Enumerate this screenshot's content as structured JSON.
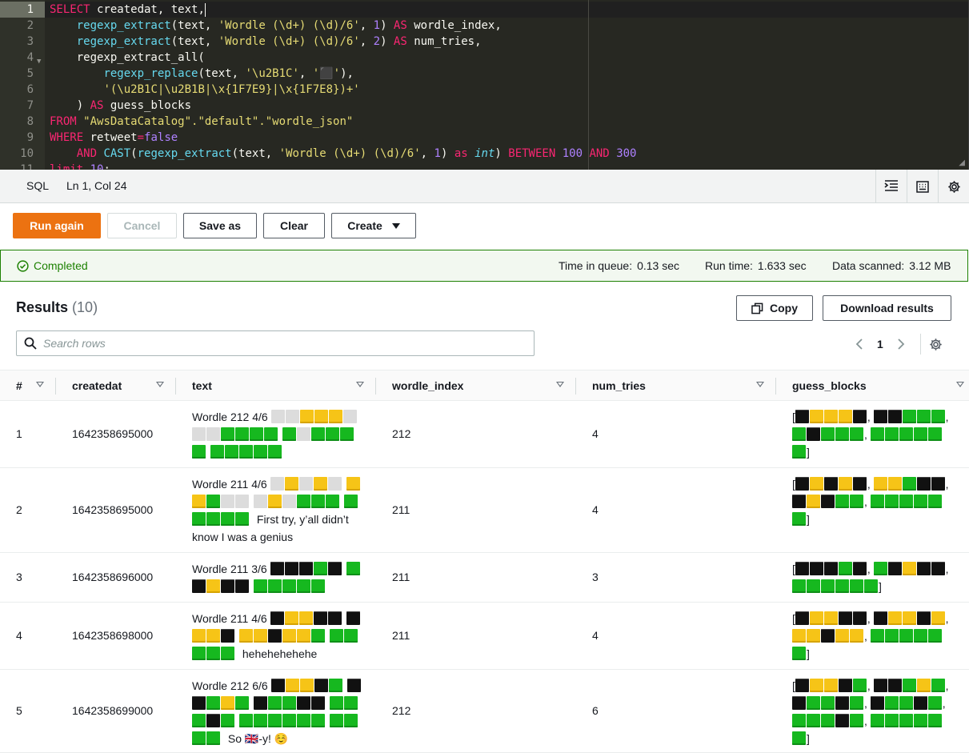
{
  "editor": {
    "line_numbers": [
      "1",
      "2",
      "3",
      "4",
      "5",
      "6",
      "7",
      "8",
      "9",
      "10",
      "11"
    ],
    "code_lines": [
      "<span class=\"k\">SELECT</span> createdat, text,<span class=\"caret\"></span>",
      "    <span class=\"f\">regexp_extract</span>(text, <span class=\"s\">'Wordle (\\d+) (\\d)/6'</span>, <span class=\"n\">1</span>) <span class=\"k\">AS</span> wordle_index,",
      "    <span class=\"f\">regexp_extract</span>(text, <span class=\"s\">'Wordle (\\d+) (\\d)/6'</span>, <span class=\"n\">2</span>) <span class=\"k\">AS</span> num_tries,",
      "    regexp_extract_all(",
      "        <span class=\"f\">regexp_replace</span>(text, <span class=\"s\">'\\u2B1C'</span>, <span class=\"s\">'⬛'</span>),",
      "        <span class=\"s\">'(\\u2B1C|\\u2B1B|\\x{1F7E9}|\\x{1F7E8})+'</span>",
      "    ) <span class=\"k\">AS</span> guess_blocks",
      "<span class=\"k\">FROM</span> <span class=\"s\">\"AwsDataCatalog\".\"default\".\"wordle_json\"</span>",
      "<span class=\"k\">WHERE</span> retweet<span class=\"o\">=</span><span class=\"n\">false</span>",
      "    <span class=\"k\">AND</span> <span class=\"f\">CAST</span>(<span class=\"f\">regexp_extract</span>(text, <span class=\"s\">'Wordle (\\d+) (\\d)/6'</span>, <span class=\"n\">1</span>) <span class=\"k\">as</span> <span class=\"t\">int</span>) <span class=\"k\">BETWEEN</span> <span class=\"n\">100</span> <span class=\"k\">AND</span> <span class=\"n\">300</span>",
      "<span class=\"k\">limit</span> <span class=\"n\">10</span>;"
    ]
  },
  "statusbar": {
    "language": "SQL",
    "position": "Ln 1, Col 24"
  },
  "actions": {
    "run_again": "Run again",
    "cancel": "Cancel",
    "save_as": "Save as",
    "clear": "Clear",
    "create": "Create"
  },
  "query_status": {
    "state": "Completed",
    "time_in_queue_label": "Time in queue:",
    "time_in_queue": "0.13 sec",
    "run_time_label": "Run time:",
    "run_time": "1.633 sec",
    "data_scanned_label": "Data scanned:",
    "data_scanned": "3.12 MB"
  },
  "results": {
    "title": "Results",
    "count": "(10)",
    "copy": "Copy",
    "download": "Download results",
    "search_placeholder": "Search rows",
    "page": "1",
    "columns": [
      "#",
      "createdat",
      "text",
      "wordle_index",
      "num_tries",
      "guess_blocks"
    ],
    "rows": [
      {
        "num": "1",
        "createdat": "1642358695000",
        "wordle_index": "212",
        "num_tries": "4",
        "text": [
          [
            "Wordle 212 4/6 ",
            "WWYYYW"
          ],
          [
            "",
            "WWGGGG"
          ],
          [
            "",
            "GWGGGG"
          ],
          [
            "",
            "GGGGG"
          ]
        ],
        "guess_blocks": "[KYYYK, KKGGG, GKGGG, GGGGGG]"
      },
      {
        "num": "2",
        "createdat": "1642358695000",
        "wordle_index": "211",
        "num_tries": "4",
        "text": [
          [
            "Wordle 211 4/6 ",
            "WYWYW"
          ],
          [
            "",
            "YYGWW"
          ],
          [
            "",
            "WYWGGG"
          ],
          [
            "",
            "GGGGG"
          ],
          [
            " First try, y’all didn’t know I was a genius",
            ""
          ]
        ],
        "guess_blocks": "[KYKYK, YYGKK, KYKGG, GGGGGG]"
      },
      {
        "num": "3",
        "createdat": "1642358696000",
        "wordle_index": "211",
        "num_tries": "3",
        "text": [
          [
            "Wordle 211 3/6 ",
            "KKKGK"
          ],
          [
            "",
            "GKYKK"
          ],
          [
            "",
            "GGGGG"
          ]
        ],
        "guess_blocks": "[KKKGK, GKYKK, GGGGGG]"
      },
      {
        "num": "4",
        "createdat": "1642358698000",
        "wordle_index": "211",
        "num_tries": "4",
        "text": [
          [
            "Wordle 211 4/6 ",
            "KYYKK"
          ],
          [
            "",
            "KYYK"
          ],
          [
            "",
            "YYKYYG"
          ],
          [
            "",
            "GGGGG"
          ],
          [
            " hehehehehehe",
            ""
          ]
        ],
        "guess_blocks": "[KYYKK, KYYKY, YYKYY, GGGGGG]"
      },
      {
        "num": "5",
        "createdat": "1642358699000",
        "wordle_index": "212",
        "num_tries": "6",
        "text": [
          [
            "Wordle 212 6/6 ",
            "KYYKG"
          ],
          [
            "",
            "KKGYG"
          ],
          [
            "",
            "KGGKK"
          ],
          [
            "",
            "GGGKG"
          ],
          [
            "",
            "GGGGGG"
          ],
          [
            "",
            "GGGG"
          ],
          [
            " So 🇬🇧-y! ☺️",
            ""
          ]
        ],
        "guess_blocks": "[KYYKG, KKGYG, KGGKG, KGGKG, GGGKG, GGGGGG]"
      }
    ]
  },
  "colors": {
    "green": "#16b81f",
    "yellow": "#f6c417",
    "black": "#111111",
    "white": "#dcdcdc",
    "accent": "#ec7211",
    "success": "#1d8102"
  },
  "icons": [
    "fold-arrow-icon",
    "format-icon",
    "keyboard-icon",
    "gear-icon",
    "check-circle-icon",
    "copy-icon",
    "search-icon",
    "chevron-left-icon",
    "chevron-right-icon",
    "caret-down-icon"
  ]
}
